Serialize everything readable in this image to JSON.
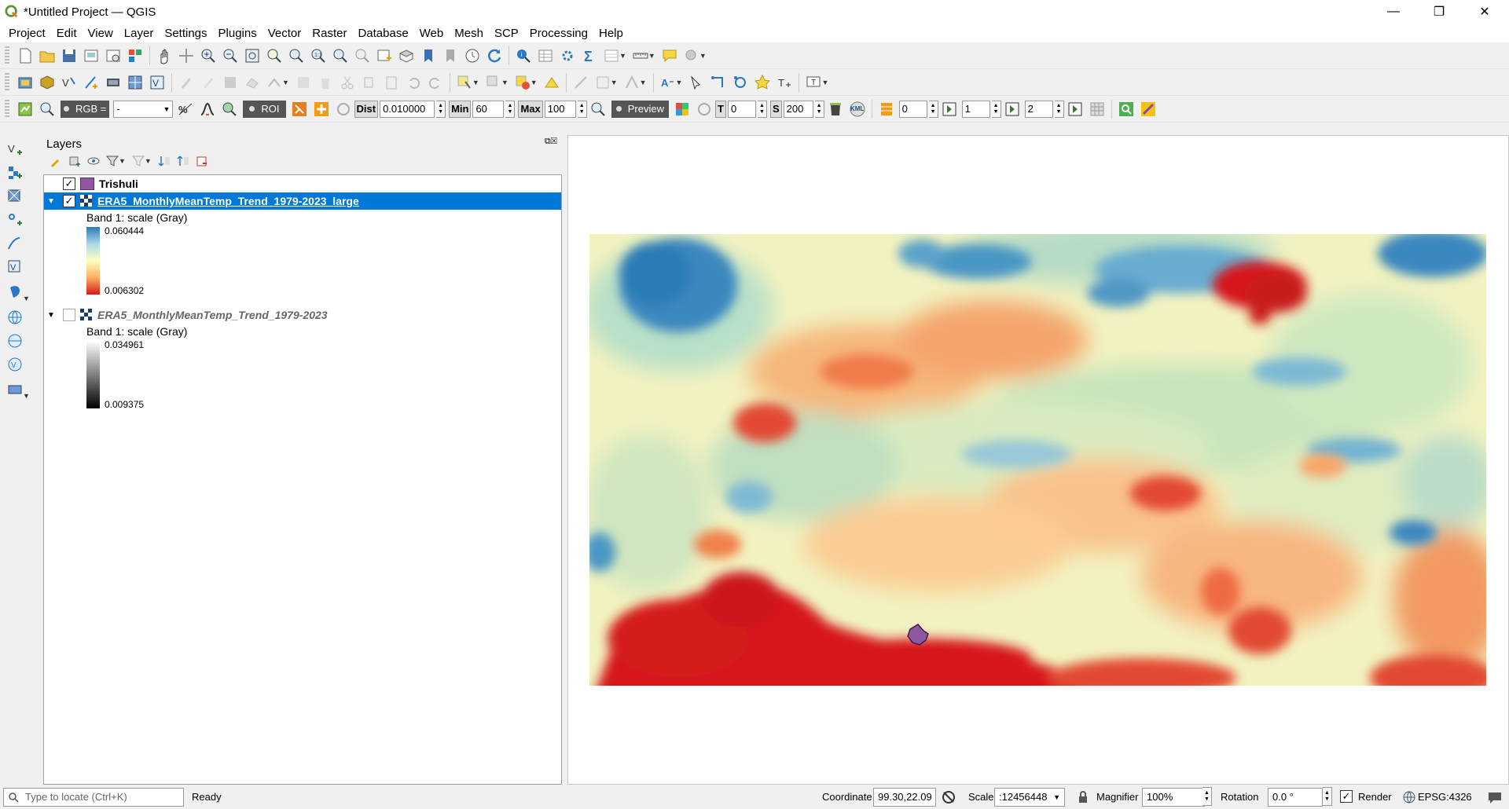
{
  "window": {
    "title": "*Untitled Project — QGIS",
    "minimize": "—",
    "restore": "❐",
    "close": "✕"
  },
  "menu": [
    "Project",
    "Edit",
    "View",
    "Layer",
    "Settings",
    "Plugins",
    "Vector",
    "Raster",
    "Database",
    "Web",
    "Mesh",
    "SCP",
    "Processing",
    "Help"
  ],
  "scp_toolbar": {
    "rgb_label": "RGB =",
    "rgb_value": "-",
    "roi_label": "ROI",
    "dist_label": "Dist",
    "dist_value": "0.010000",
    "min_label": "Min",
    "min_value": "60",
    "max_label": "Max",
    "max_value": "100",
    "preview_label": "Preview",
    "t_label": "T",
    "t_value": "0",
    "s_label": "S",
    "s_value": "200",
    "kml_label": "KML",
    "band_a": "0",
    "band_b": "1",
    "band_c": "2"
  },
  "layers_panel": {
    "title": "Layers",
    "items": [
      {
        "name": "Trishuli",
        "checked": true,
        "color": "#8e57a0"
      },
      {
        "name": "ERA5_MonthlyMeanTemp_Trend_1979-2023_large",
        "checked": true,
        "selected": true,
        "band_label": "Band 1: scale (Gray)",
        "max": "0.060444",
        "min": "0.006302"
      },
      {
        "name": "ERA5_MonthlyMeanTemp_Trend_1979-2023",
        "checked": false,
        "band_label": "Band 1: scale (Gray)",
        "max": "0.034961",
        "min": "0.009375"
      }
    ]
  },
  "status": {
    "locate_placeholder": "Type to locate (Ctrl+K)",
    "ready": "Ready",
    "coordinate_label": "Coordinate",
    "coordinate_value": "99.30,22.09",
    "scale_label": "Scale",
    "scale_value": ":12456448",
    "magnifier_label": "Magnifier",
    "magnifier_value": "100%",
    "rotation_label": "Rotation",
    "rotation_value": "0.0 °",
    "render_label": "Render",
    "crs": "EPSG:4326"
  },
  "colors": {
    "accent": "#0078d7",
    "polygon": "#8e57a0",
    "ramp_hi": "#2c7bb6",
    "ramp_mid": "#ffffbf",
    "ramp_lo": "#d7191c"
  }
}
